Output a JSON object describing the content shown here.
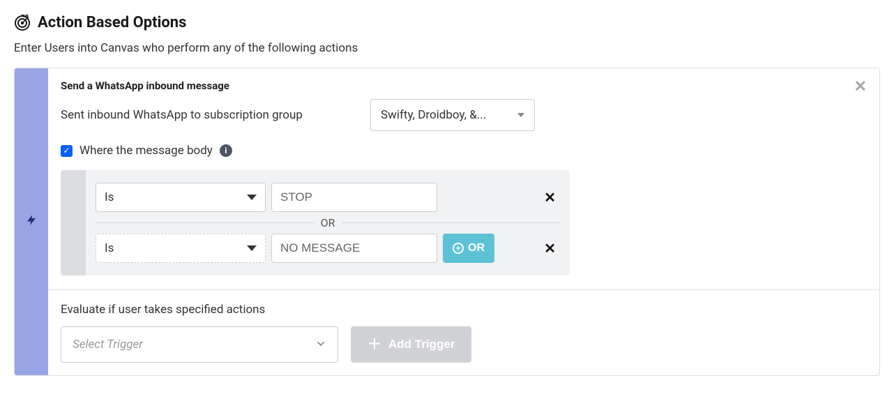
{
  "header": {
    "title": "Action Based Options",
    "subtitle": "Enter Users into Canvas who perform any of the following actions"
  },
  "trigger_section": {
    "title": "Send a WhatsApp inbound message",
    "subscription_row": {
      "label": "Sent inbound WhatsApp to subscription group",
      "selected": "Swifty, Droidboy, &..."
    },
    "body_filter": {
      "checkbox_checked": true,
      "label": "Where the message body",
      "rules": [
        {
          "operator": "Is",
          "value": "STOP"
        },
        {
          "operator": "Is",
          "value": "NO MESSAGE"
        }
      ],
      "or_divider": "OR",
      "or_button": "OR"
    }
  },
  "evaluate_section": {
    "label": "Evaluate if user takes specified actions",
    "select_placeholder": "Select Trigger",
    "add_button": "Add Trigger"
  }
}
